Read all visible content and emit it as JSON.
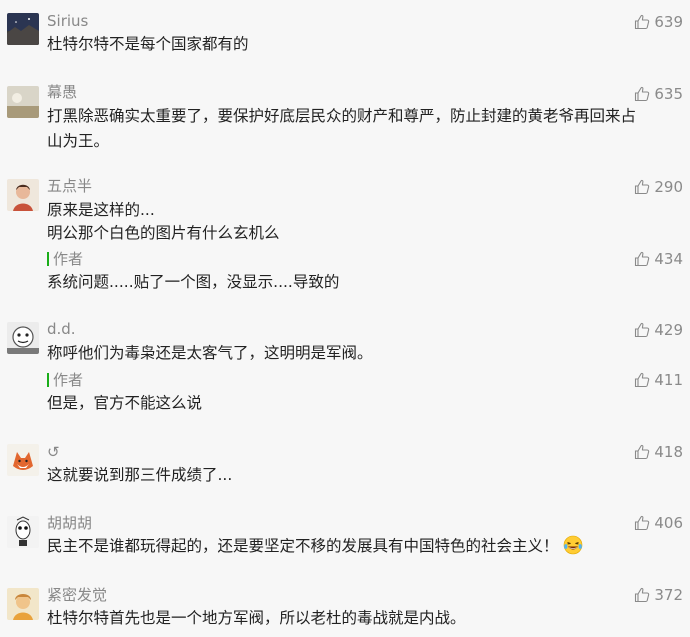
{
  "comments": [
    {
      "nickname": "Sirius",
      "likes": "639",
      "text": "杜特尔特不是每个国家都有的"
    },
    {
      "nickname": "幕愚",
      "likes": "635",
      "text_line1": "打黑除恶确实太重要了，要保护好底层民众的财产和尊严，防止封建的黄老爷再回来占",
      "text_line2": "山为王。"
    },
    {
      "nickname": "五点半",
      "likes": "290",
      "text_line1": "原来是这样的...",
      "text_line2": "明公那个白色的图片有什么玄机么",
      "reply": {
        "label": "作者",
        "likes": "434",
        "text": "系统问题.....贴了一个图，没显示....导致的"
      }
    },
    {
      "nickname": "d.d.",
      "likes": "429",
      "text": "称呼他们为毒枭还是太客气了，这明明是军阀。",
      "reply": {
        "label": "作者",
        "likes": "411",
        "text": "但是，官方不能这么说"
      }
    },
    {
      "nickname": "↺",
      "likes": "418",
      "text": "这就要说到那三件成绩了..."
    },
    {
      "nickname": "胡胡胡",
      "likes": "406",
      "text": "民主不是谁都玩得起的，还是要坚定不移的发展具有中国特色的社会主义！",
      "emoji": "laughing-tears-emoji"
    },
    {
      "nickname": "紧密发觉",
      "likes": "372",
      "text": "杜特尔特首先也是一个地方军阀，所以老杜的毒战就是内战。"
    }
  ],
  "icons": {
    "like": "thumbs-up-icon"
  },
  "colors": {
    "author_bar": "#1aad19",
    "text": "#222222",
    "meta": "#888888"
  }
}
